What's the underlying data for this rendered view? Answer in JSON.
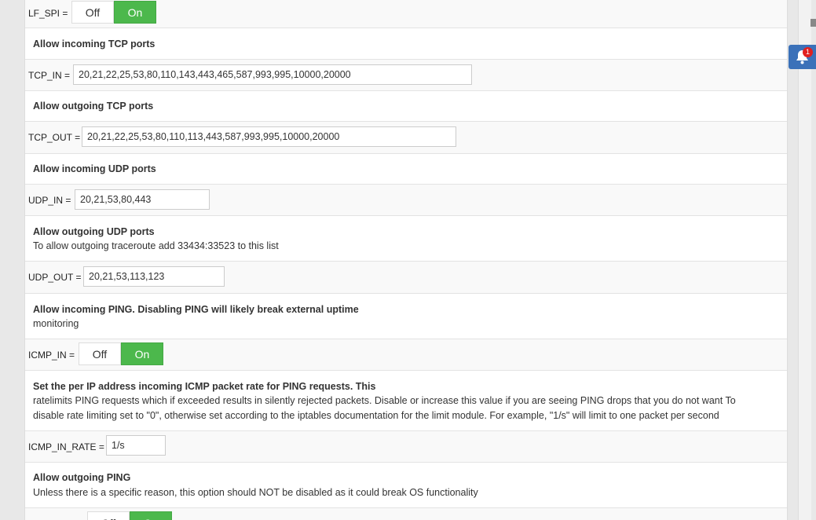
{
  "options": {
    "lf_spi": {
      "label": "LF_SPI",
      "off": "Off",
      "on": "On"
    },
    "tcp_in": {
      "title": "Allow incoming TCP ports",
      "label": "TCP_IN",
      "value": "20,21,22,25,53,80,110,143,443,465,587,993,995,10000,20000"
    },
    "tcp_out": {
      "title": "Allow outgoing TCP ports",
      "label": "TCP_OUT",
      "value": "20,21,22,25,53,80,110,113,443,587,993,995,10000,20000"
    },
    "udp_in": {
      "title": "Allow incoming UDP ports",
      "label": "UDP_IN",
      "value": "20,21,53,80,443"
    },
    "udp_out": {
      "title": "Allow outgoing UDP ports",
      "desc": "To allow outgoing traceroute add 33434:33523 to this list",
      "label": "UDP_OUT",
      "value": "20,21,53,113,123"
    },
    "icmp_in": {
      "title": "Allow incoming PING. Disabling PING will likely break external uptime",
      "desc": "monitoring",
      "label": "ICMP_IN",
      "off": "Off",
      "on": "On"
    },
    "icmp_in_rate": {
      "title": "Set the per IP address incoming ICMP packet rate for PING requests. This",
      "desc1": "ratelimits PING requests which if exceeded results in silently rejected packets. Disable or increase this value if you are seeing PING drops that you do not want To",
      "desc2": "disable rate limiting set to \"0\", otherwise set according to the iptables documentation for the limit module. For example, \"1/s\" will limit to one packet per second",
      "label": "ICMP_IN_RATE",
      "value": "1/s"
    },
    "icmp_out": {
      "title": "Allow outgoing PING",
      "desc": "Unless there is a specific reason, this option should NOT be disabled as it could break OS functionality",
      "off": "Off",
      "on": "On"
    }
  },
  "equals": "=",
  "notification": {
    "count": "1"
  },
  "colors": {
    "on": "#4cb84c",
    "bell": "#3b71b9",
    "badge": "#e02020"
  }
}
